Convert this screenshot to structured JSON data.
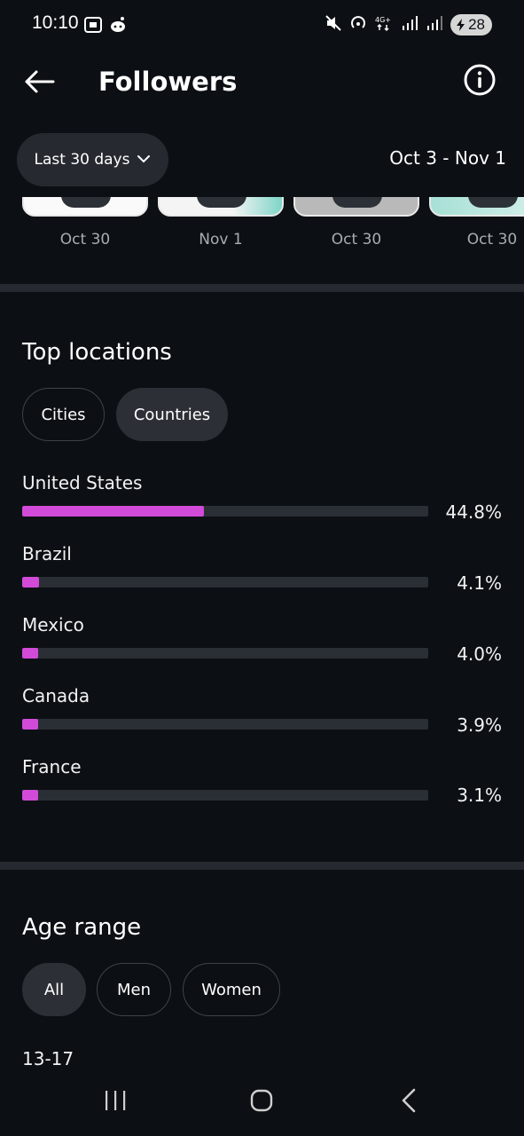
{
  "status_bar": {
    "time": "10:10",
    "battery": "28",
    "left_icons": [
      "screenshot-icon",
      "reddit-icon"
    ],
    "right_icons": [
      "mute-icon",
      "hotspot-icon",
      "4g-icon",
      "signal-icon",
      "signal-icon-2",
      "battery-icon"
    ]
  },
  "header": {
    "title": "Followers",
    "back_icon": "back-arrow-icon",
    "info_icon": "info-icon"
  },
  "filter": {
    "range_label": "Last 30 days",
    "date_range": "Oct 3 - Nov 1"
  },
  "thumbnails": [
    {
      "date": "Oct 30"
    },
    {
      "date": "Nov 1"
    },
    {
      "date": "Oct 30"
    },
    {
      "date": "Oct 30"
    }
  ],
  "top_locations": {
    "title": "Top locations",
    "tabs": [
      "Cities",
      "Countries"
    ],
    "selected_tab": "Countries",
    "items": [
      {
        "name": "United States",
        "percent": "44.8%",
        "value": 44.8
      },
      {
        "name": "Brazil",
        "percent": "4.1%",
        "value": 4.1
      },
      {
        "name": "Mexico",
        "percent": "4.0%",
        "value": 4.0
      },
      {
        "name": "Canada",
        "percent": "3.9%",
        "value": 3.9
      },
      {
        "name": "France",
        "percent": "3.1%",
        "value": 3.1
      }
    ]
  },
  "age_range": {
    "title": "Age range",
    "tabs": [
      "All",
      "Men",
      "Women"
    ],
    "selected_tab": "All",
    "first_row_label": "13-17"
  },
  "colors": {
    "background": "#0c1014",
    "accent_bar": "#d24ad8",
    "track": "#2a2e35",
    "chip_filled": "#2c3036"
  }
}
